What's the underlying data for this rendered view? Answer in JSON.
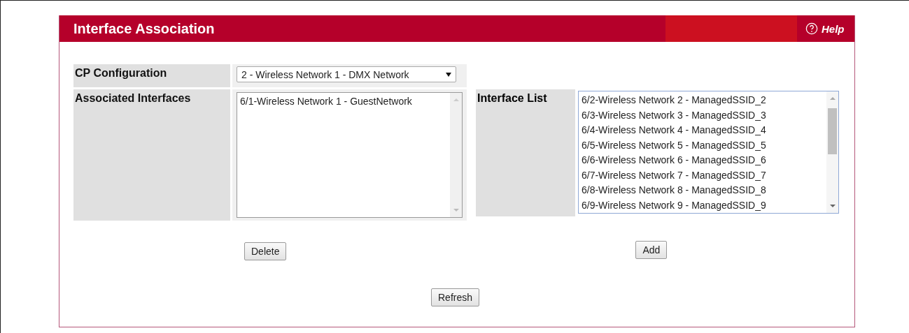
{
  "header": {
    "title": "Interface Association",
    "help": "Help"
  },
  "cp_configuration": {
    "label": "CP Configuration",
    "value": "2 - Wireless Network 1 - DMX Network"
  },
  "associated_interfaces": {
    "label": "Associated Interfaces",
    "items": [
      {
        "text": "6/1-Wireless Network 1 - GuestNetwork",
        "selected": false
      }
    ]
  },
  "interface_list": {
    "label": "Interface List",
    "items": [
      {
        "text": "6/2-Wireless Network 2 - ManagedSSID_2",
        "selected": false
      },
      {
        "text": "6/3-Wireless Network 3 - ManagedSSID_3",
        "selected": false
      },
      {
        "text": "6/4-Wireless Network 4 - ManagedSSID_4",
        "selected": false
      },
      {
        "text": "6/5-Wireless Network 5 - ManagedSSID_5",
        "selected": false
      },
      {
        "text": "6/6-Wireless Network 6 - ManagedSSID_6",
        "selected": false
      },
      {
        "text": "6/7-Wireless Network 7 - ManagedSSID_7",
        "selected": false
      },
      {
        "text": "6/8-Wireless Network 8 - ManagedSSID_8",
        "selected": false
      },
      {
        "text": "6/9-Wireless Network 9 - ManagedSSID_9",
        "selected": false
      }
    ]
  },
  "buttons": {
    "delete": "Delete",
    "add": "Add",
    "refresh": "Refresh"
  }
}
